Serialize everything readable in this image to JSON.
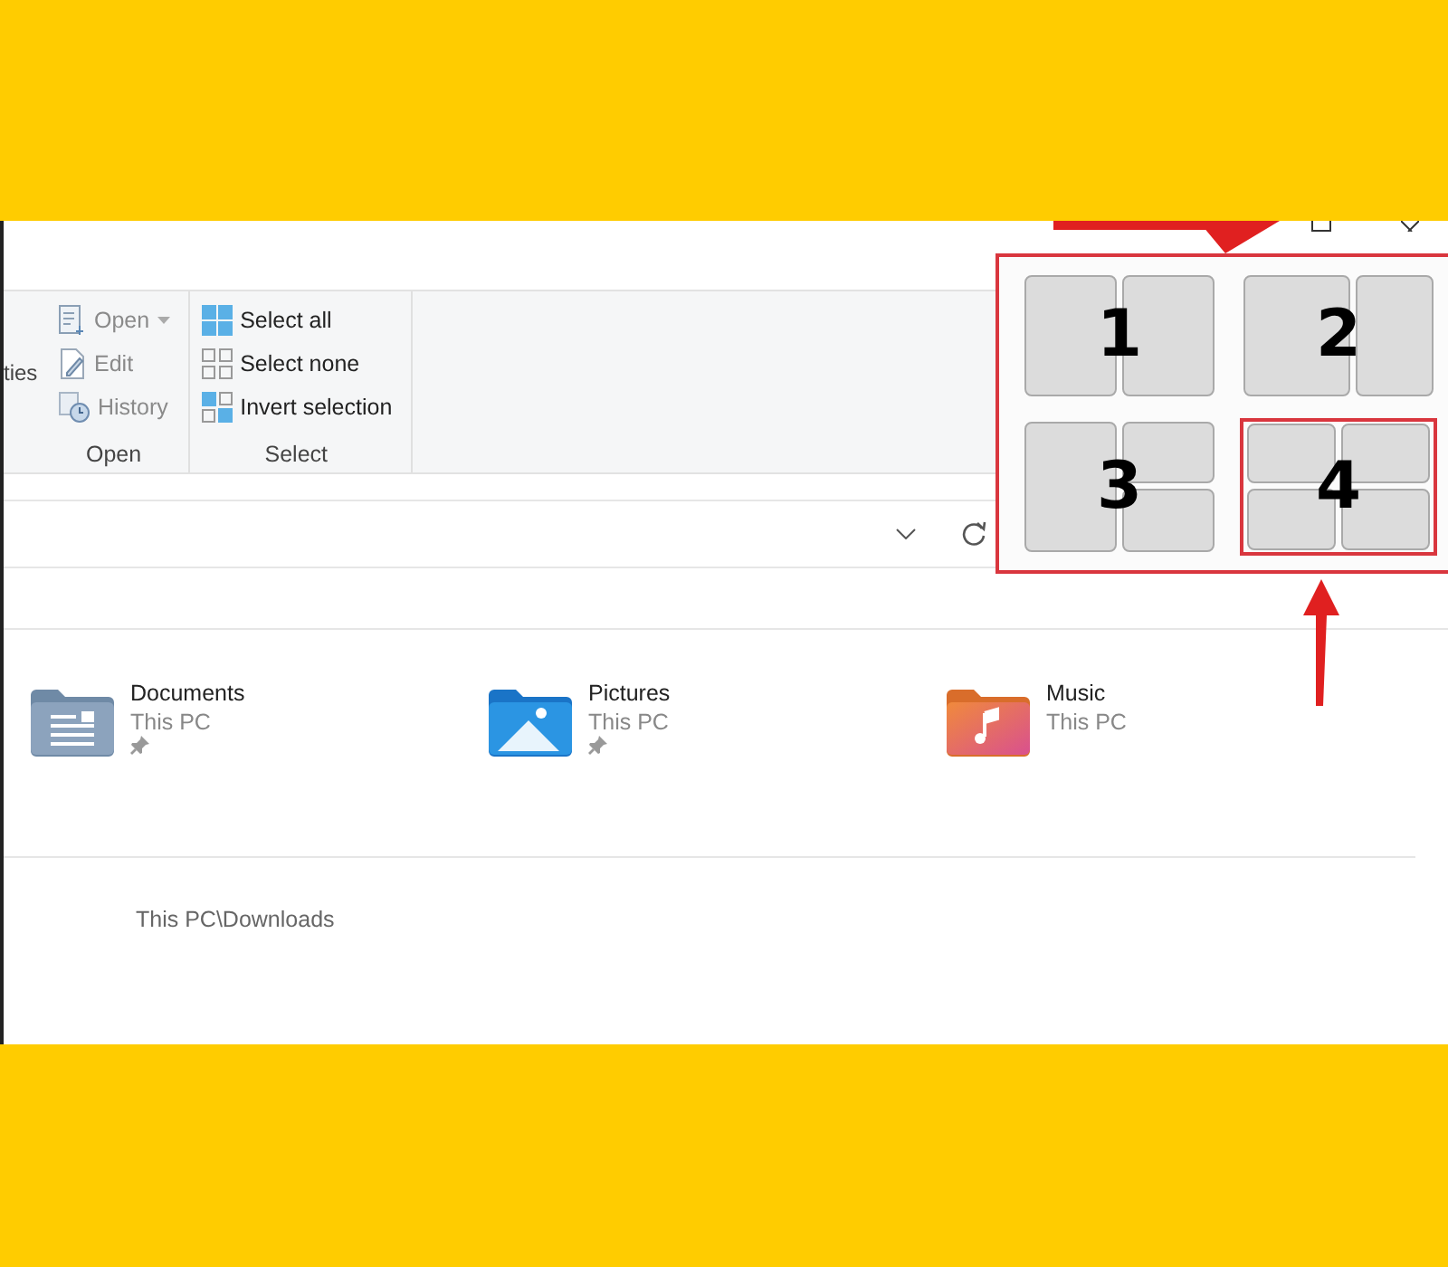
{
  "ribbon": {
    "cut_label": "ties",
    "groups": [
      {
        "label": "Open",
        "items": [
          {
            "label": "Open",
            "kind": "open",
            "dropdown": true,
            "disabled": true
          },
          {
            "label": "Edit",
            "kind": "edit",
            "dropdown": false,
            "disabled": true
          },
          {
            "label": "History",
            "kind": "history",
            "dropdown": false,
            "disabled": true
          }
        ]
      },
      {
        "label": "Select",
        "items": [
          {
            "label": "Select all",
            "kind": "select-all",
            "dropdown": false,
            "disabled": false
          },
          {
            "label": "Select none",
            "kind": "select-none",
            "dropdown": false,
            "disabled": false
          },
          {
            "label": "Invert selection",
            "kind": "invert",
            "dropdown": false,
            "disabled": false
          }
        ]
      }
    ]
  },
  "quick_access": [
    {
      "name": "Documents",
      "location": "This PC",
      "kind": "documents",
      "pinned": true
    },
    {
      "name": "Pictures",
      "location": "This PC",
      "kind": "pictures",
      "pinned": true
    },
    {
      "name": "Music",
      "location": "This PC",
      "kind": "music",
      "pinned": false
    }
  ],
  "recent": {
    "location": "This PC\\Downloads"
  },
  "snap_layouts": [
    {
      "number": "1",
      "kind": "halves",
      "selected": false
    },
    {
      "number": "2",
      "kind": "wide-left",
      "selected": false
    },
    {
      "number": "3",
      "kind": "left-split-right",
      "selected": false
    },
    {
      "number": "4",
      "kind": "quad",
      "selected": true
    }
  ]
}
